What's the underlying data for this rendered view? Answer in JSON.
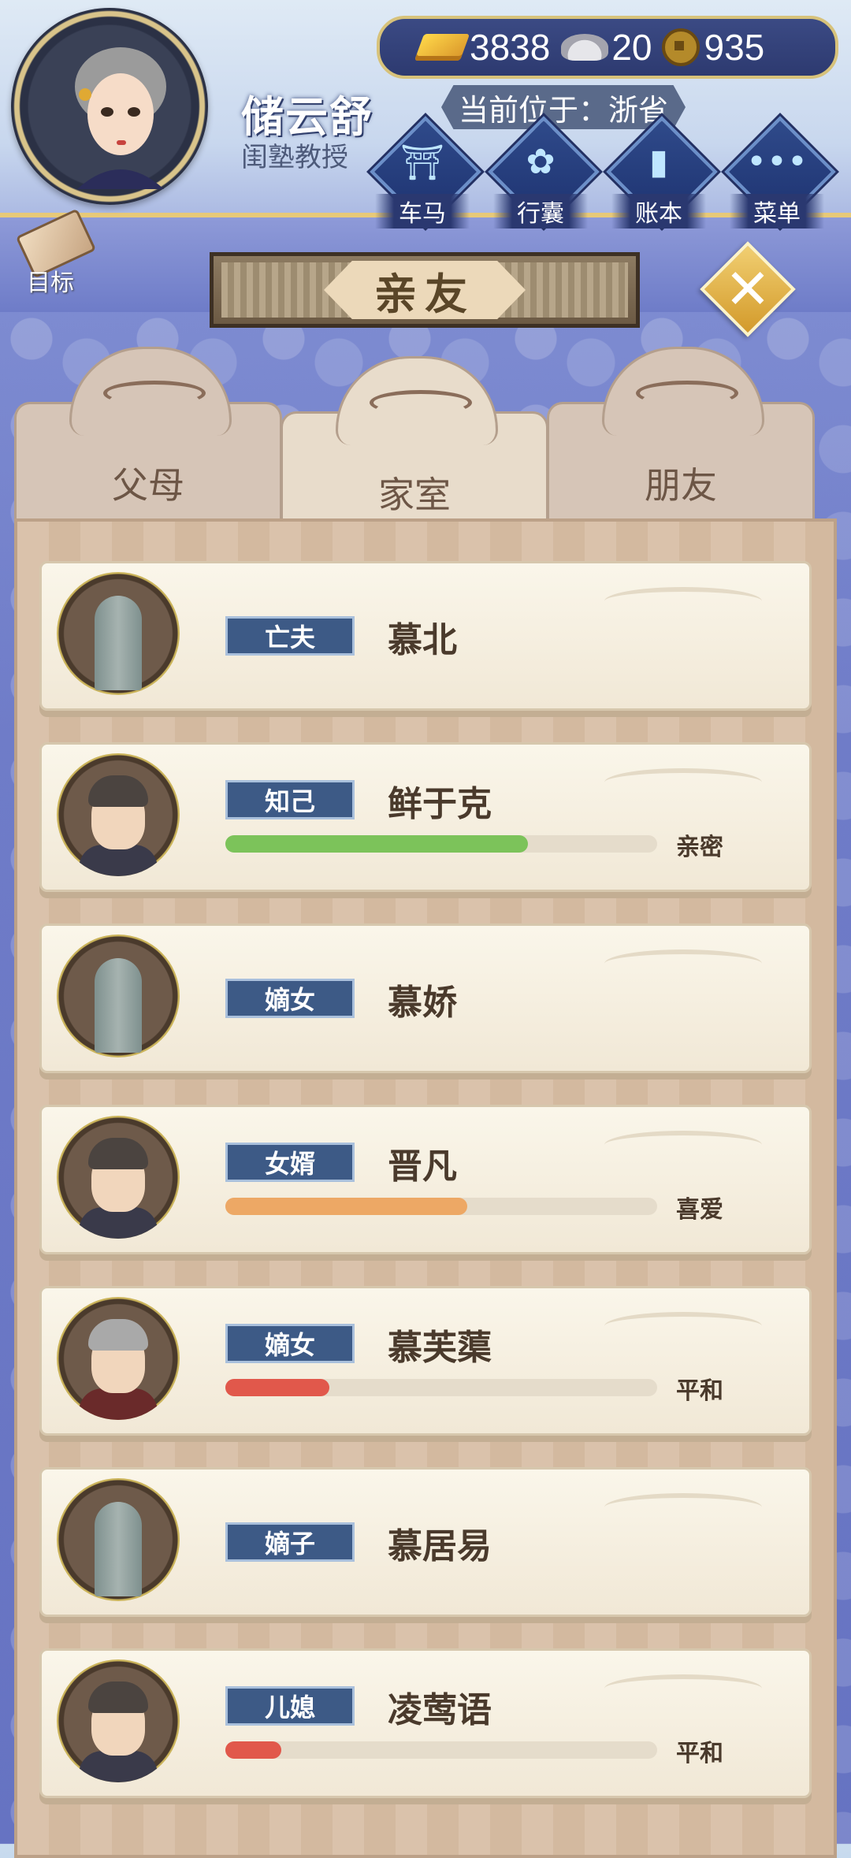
{
  "player": {
    "name": "储云舒",
    "title": "闺塾教授"
  },
  "currency": {
    "gold": "3838",
    "silver": "20",
    "coins": "935"
  },
  "location": "当前位于：浙省",
  "menu": [
    {
      "label": "车马",
      "icon": "carriage-icon"
    },
    {
      "label": "行囊",
      "icon": "bag-icon"
    },
    {
      "label": "账本",
      "icon": "ledger-icon"
    },
    {
      "label": "菜单",
      "icon": "more-icon"
    }
  ],
  "goal_label": "目标",
  "page_title": "亲友",
  "tabs": [
    {
      "label": "父母",
      "active": false
    },
    {
      "label": "家室",
      "active": true
    },
    {
      "label": "朋友",
      "active": false
    }
  ],
  "relations": [
    {
      "relation": "亡夫",
      "name": "慕北",
      "deceased": true,
      "status": "",
      "affinity": null,
      "bar_color": ""
    },
    {
      "relation": "知己",
      "name": "鲜于克",
      "deceased": false,
      "status": "亲密",
      "affinity": 0.7,
      "bar_color": "#7cc35a"
    },
    {
      "relation": "嫡女",
      "name": "慕娇",
      "deceased": true,
      "status": "",
      "affinity": null,
      "bar_color": ""
    },
    {
      "relation": "女婿",
      "name": "晋凡",
      "deceased": false,
      "status": "喜爱",
      "affinity": 0.56,
      "bar_color": "#eda865"
    },
    {
      "relation": "嫡女",
      "name": "慕芙蕖",
      "deceased": false,
      "status": "平和",
      "affinity": 0.24,
      "bar_color": "#e1584b"
    },
    {
      "relation": "嫡子",
      "name": "慕居易",
      "deceased": true,
      "status": "",
      "affinity": null,
      "bar_color": ""
    },
    {
      "relation": "儿媳",
      "name": "凌莺语",
      "deceased": false,
      "status": "平和",
      "affinity": 0.13,
      "bar_color": "#e1584b"
    }
  ]
}
